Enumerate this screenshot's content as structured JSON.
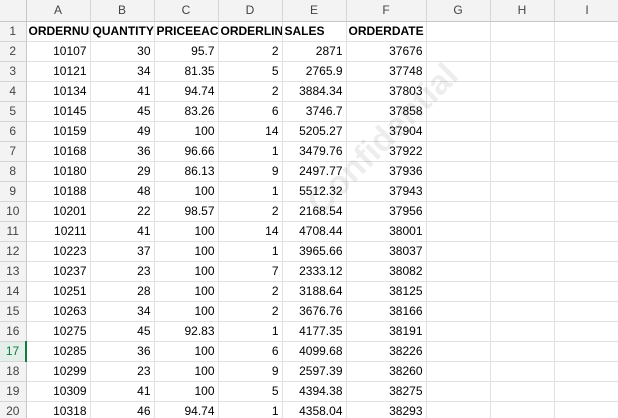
{
  "columns": [
    "A",
    "B",
    "C",
    "D",
    "E",
    "F",
    "G",
    "H",
    "I"
  ],
  "rows": [
    {
      "n": "1",
      "cells": [
        "ORDERNUMBER",
        "QUANTITYORDERED",
        "PRICEEACH",
        "ORDERLINENUMBER",
        "SALES",
        "ORDERDATE"
      ]
    },
    {
      "n": "2",
      "cells": [
        "10107",
        "30",
        "95.7",
        "2",
        "2871",
        "37676"
      ]
    },
    {
      "n": "3",
      "cells": [
        "10121",
        "34",
        "81.35",
        "5",
        "2765.9",
        "37748"
      ]
    },
    {
      "n": "4",
      "cells": [
        "10134",
        "41",
        "94.74",
        "2",
        "3884.34",
        "37803"
      ]
    },
    {
      "n": "5",
      "cells": [
        "10145",
        "45",
        "83.26",
        "6",
        "3746.7",
        "37858"
      ]
    },
    {
      "n": "6",
      "cells": [
        "10159",
        "49",
        "100",
        "14",
        "5205.27",
        "37904"
      ]
    },
    {
      "n": "7",
      "cells": [
        "10168",
        "36",
        "96.66",
        "1",
        "3479.76",
        "37922"
      ]
    },
    {
      "n": "8",
      "cells": [
        "10180",
        "29",
        "86.13",
        "9",
        "2497.77",
        "37936"
      ]
    },
    {
      "n": "9",
      "cells": [
        "10188",
        "48",
        "100",
        "1",
        "5512.32",
        "37943"
      ]
    },
    {
      "n": "10",
      "cells": [
        "10201",
        "22",
        "98.57",
        "2",
        "2168.54",
        "37956"
      ]
    },
    {
      "n": "11",
      "cells": [
        "10211",
        "41",
        "100",
        "14",
        "4708.44",
        "38001"
      ]
    },
    {
      "n": "12",
      "cells": [
        "10223",
        "37",
        "100",
        "1",
        "3965.66",
        "38037"
      ]
    },
    {
      "n": "13",
      "cells": [
        "10237",
        "23",
        "100",
        "7",
        "2333.12",
        "38082"
      ]
    },
    {
      "n": "14",
      "cells": [
        "10251",
        "28",
        "100",
        "2",
        "3188.64",
        "38125"
      ]
    },
    {
      "n": "15",
      "cells": [
        "10263",
        "34",
        "100",
        "2",
        "3676.76",
        "38166"
      ]
    },
    {
      "n": "16",
      "cells": [
        "10275",
        "45",
        "92.83",
        "1",
        "4177.35",
        "38191"
      ]
    },
    {
      "n": "17",
      "cells": [
        "10285",
        "36",
        "100",
        "6",
        "4099.68",
        "38226"
      ]
    },
    {
      "n": "18",
      "cells": [
        "10299",
        "23",
        "100",
        "9",
        "2597.39",
        "38260"
      ]
    },
    {
      "n": "19",
      "cells": [
        "10309",
        "41",
        "100",
        "5",
        "4394.38",
        "38275"
      ]
    },
    {
      "n": "20",
      "cells": [
        "10318",
        "46",
        "94.74",
        "1",
        "4358.04",
        "38293"
      ]
    }
  ],
  "active_row": "17",
  "watermark": "Confidential"
}
